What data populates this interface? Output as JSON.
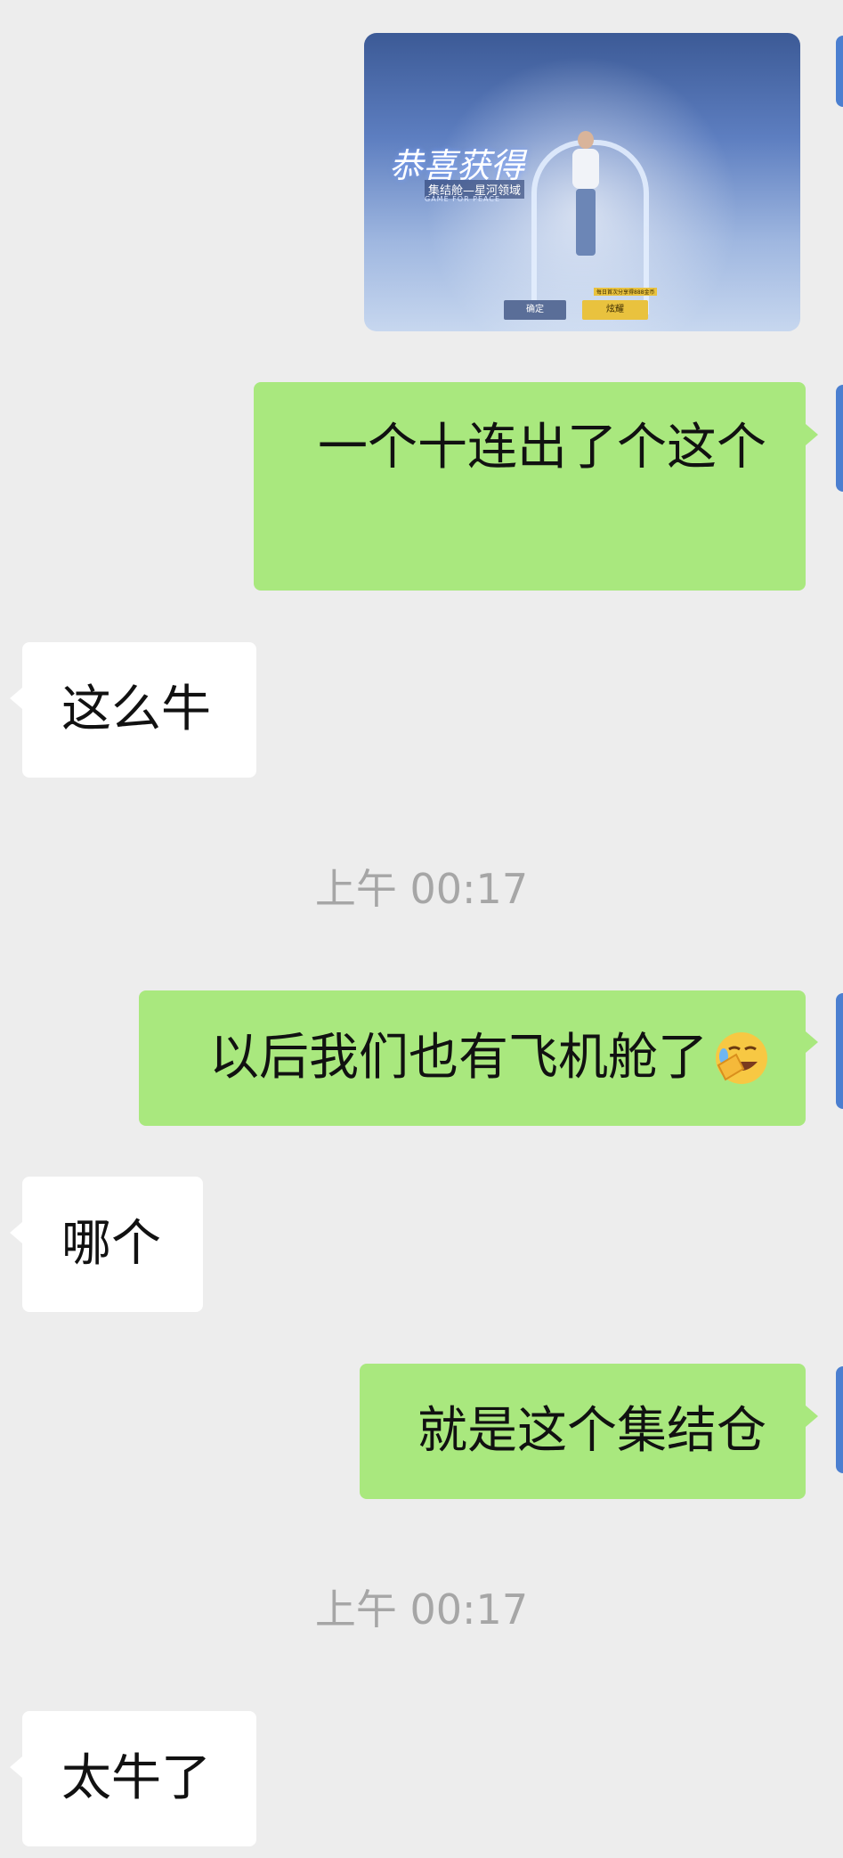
{
  "image_message": {
    "title": "恭喜获得",
    "subtitle": "集结舱—星河领域",
    "caption": "GAME FOR PEACE",
    "confirm_label": "确定",
    "share_label": "炫耀",
    "badge": "每日首次分享得888金币"
  },
  "messages": [
    {
      "side": "out",
      "text": "一个十连出了个这个"
    },
    {
      "side": "in",
      "text": "这么牛"
    },
    {
      "side": "out",
      "text": "以后我们也有飞机舱了"
    },
    {
      "side": "in",
      "text": "哪个"
    },
    {
      "side": "out",
      "text": "就是这个集结仓"
    },
    {
      "side": "in",
      "text": "太牛了"
    }
  ],
  "timestamps": [
    "上午 00:17",
    "上午 00:17"
  ],
  "emoji": "facepalm-laugh-emoji",
  "colors": {
    "outgoing": "#a9e87e",
    "incoming": "#ffffff",
    "background": "#ededed",
    "timestamp": "#a6a6a6"
  }
}
